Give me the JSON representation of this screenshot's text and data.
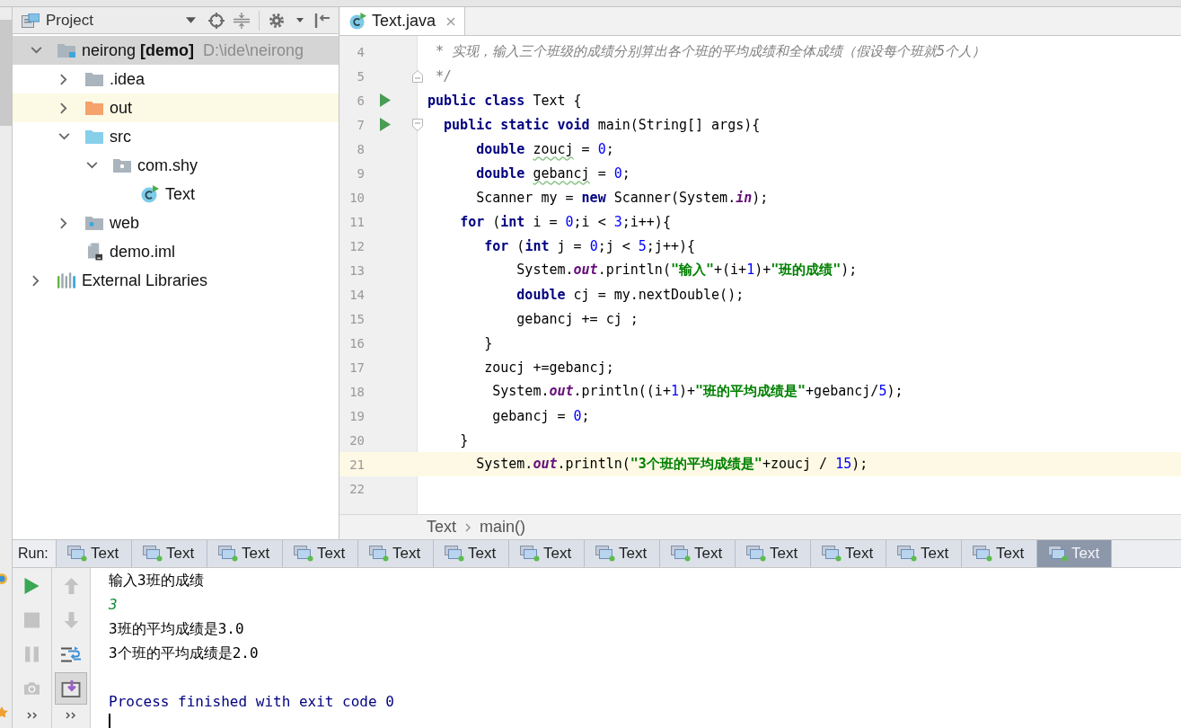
{
  "project_panel": {
    "title": "Project",
    "tree": [
      {
        "label": "neirong **[demo]**",
        "path": "D:\\ide\\neirong",
        "kind": "module",
        "expanded": true,
        "selected": true,
        "children": [
          {
            "label": ".idea",
            "kind": "folder",
            "expanded": false,
            "selected": false
          },
          {
            "label": "out",
            "kind": "excluded_folder",
            "expanded": false,
            "selected": false,
            "highlighted": true
          },
          {
            "label": "src",
            "kind": "source_folder",
            "expanded": true,
            "selected": false,
            "children": [
              {
                "label": "com.shy",
                "kind": "package",
                "expanded": true,
                "selected": false,
                "children": [
                  {
                    "label": "Text",
                    "kind": "class",
                    "selected": false
                  }
                ]
              }
            ]
          },
          {
            "label": "web",
            "kind": "web_folder",
            "expanded": false,
            "selected": false
          },
          {
            "label": "demo.iml",
            "kind": "module_file",
            "selected": false
          }
        ]
      },
      {
        "label": "External Libraries",
        "kind": "library",
        "expanded": false,
        "selected": false
      }
    ]
  },
  "editor": {
    "tabs": [
      {
        "label": "Text.java",
        "selected": true
      }
    ],
    "lines": [
      {
        "number": "4",
        "run_marker": false,
        "current": false,
        "tokens": [
          {
            "kind": "comment",
            "text": " * 实现，输入三个班级的成绩分别算出各个班的平均成绩和全体成绩（假设每个班就5个人）"
          }
        ]
      },
      {
        "number": "5",
        "run_marker": false,
        "current": false,
        "fold_end": true,
        "tokens": [
          {
            "kind": "comment",
            "text": " */"
          }
        ]
      },
      {
        "number": "6",
        "run_marker": true,
        "current": false,
        "tokens": [
          {
            "kind": "keyword",
            "text": "public class"
          },
          {
            "kind": "plain",
            "text": " Text {"
          }
        ]
      },
      {
        "number": "7",
        "run_marker": true,
        "current": false,
        "fold_start": true,
        "tokens": [
          {
            "kind": "keyword",
            "text": "  public static void"
          },
          {
            "kind": "plain",
            "text": " main(String[] args){"
          }
        ]
      },
      {
        "number": "8",
        "run_marker": false,
        "current": false,
        "tokens": [
          {
            "kind": "keyword",
            "text": "      double "
          },
          {
            "kind": "typo",
            "text": "zoucj"
          },
          {
            "kind": "plain",
            "text": " = "
          },
          {
            "kind": "number",
            "text": "0"
          },
          {
            "kind": "plain",
            "text": ";"
          }
        ]
      },
      {
        "number": "9",
        "run_marker": false,
        "current": false,
        "tokens": [
          {
            "kind": "keyword",
            "text": "      double "
          },
          {
            "kind": "typo",
            "text": "gebancj"
          },
          {
            "kind": "plain",
            "text": " = "
          },
          {
            "kind": "number",
            "text": "0"
          },
          {
            "kind": "plain",
            "text": ";"
          }
        ]
      },
      {
        "number": "10",
        "run_marker": false,
        "current": false,
        "tokens": [
          {
            "kind": "plain",
            "text": "      Scanner my = "
          },
          {
            "kind": "keyword",
            "text": "new"
          },
          {
            "kind": "plain",
            "text": " Scanner(System."
          },
          {
            "kind": "static_field",
            "text": "in"
          },
          {
            "kind": "plain",
            "text": ");"
          }
        ]
      },
      {
        "number": "11",
        "run_marker": false,
        "current": false,
        "tokens": [
          {
            "kind": "keyword",
            "text": "    for"
          },
          {
            "kind": "plain",
            "text": " ("
          },
          {
            "kind": "keyword",
            "text": "int"
          },
          {
            "kind": "plain",
            "text": " i = "
          },
          {
            "kind": "number",
            "text": "0"
          },
          {
            "kind": "plain",
            "text": ";i < "
          },
          {
            "kind": "number",
            "text": "3"
          },
          {
            "kind": "plain",
            "text": ";i++){"
          }
        ]
      },
      {
        "number": "12",
        "run_marker": false,
        "current": false,
        "tokens": [
          {
            "kind": "keyword",
            "text": "       for"
          },
          {
            "kind": "plain",
            "text": " ("
          },
          {
            "kind": "keyword",
            "text": "int"
          },
          {
            "kind": "plain",
            "text": " j = "
          },
          {
            "kind": "number",
            "text": "0"
          },
          {
            "kind": "plain",
            "text": ";j < "
          },
          {
            "kind": "number",
            "text": "5"
          },
          {
            "kind": "plain",
            "text": ";j++){"
          }
        ]
      },
      {
        "number": "13",
        "run_marker": false,
        "current": false,
        "tokens": [
          {
            "kind": "plain",
            "text": "           System."
          },
          {
            "kind": "static_field",
            "text": "out"
          },
          {
            "kind": "plain",
            "text": ".println("
          },
          {
            "kind": "string",
            "text": "\"输入\""
          },
          {
            "kind": "plain",
            "text": "+(i+"
          },
          {
            "kind": "number",
            "text": "1"
          },
          {
            "kind": "plain",
            "text": ")+"
          },
          {
            "kind": "string",
            "text": "\"班的成绩\""
          },
          {
            "kind": "plain",
            "text": ");"
          }
        ]
      },
      {
        "number": "14",
        "run_marker": false,
        "current": false,
        "tokens": [
          {
            "kind": "keyword",
            "text": "           double"
          },
          {
            "kind": "plain",
            "text": " cj = my.nextDouble();"
          }
        ]
      },
      {
        "number": "15",
        "run_marker": false,
        "current": false,
        "tokens": [
          {
            "kind": "plain",
            "text": "           gebancj += cj ;"
          }
        ]
      },
      {
        "number": "16",
        "run_marker": false,
        "current": false,
        "tokens": [
          {
            "kind": "plain",
            "text": "       }"
          }
        ]
      },
      {
        "number": "17",
        "run_marker": false,
        "current": false,
        "tokens": [
          {
            "kind": "plain",
            "text": "       zoucj +=gebancj;"
          }
        ]
      },
      {
        "number": "18",
        "run_marker": false,
        "current": false,
        "tokens": [
          {
            "kind": "plain",
            "text": "        System."
          },
          {
            "kind": "static_field",
            "text": "out"
          },
          {
            "kind": "plain",
            "text": ".println((i+"
          },
          {
            "kind": "number",
            "text": "1"
          },
          {
            "kind": "plain",
            "text": ")+"
          },
          {
            "kind": "string",
            "text": "\"班的平均成绩是\""
          },
          {
            "kind": "plain",
            "text": "+gebancj/"
          },
          {
            "kind": "number",
            "text": "5"
          },
          {
            "kind": "plain",
            "text": ");"
          }
        ]
      },
      {
        "number": "19",
        "run_marker": false,
        "current": false,
        "tokens": [
          {
            "kind": "plain",
            "text": "        gebancj = "
          },
          {
            "kind": "number",
            "text": "0"
          },
          {
            "kind": "plain",
            "text": ";"
          }
        ]
      },
      {
        "number": "20",
        "run_marker": false,
        "current": false,
        "tokens": [
          {
            "kind": "plain",
            "text": "    }"
          }
        ]
      },
      {
        "number": "21",
        "run_marker": false,
        "current": true,
        "tokens": [
          {
            "kind": "plain",
            "text": "      System."
          },
          {
            "kind": "static_field",
            "text": "out"
          },
          {
            "kind": "plain",
            "text": ".println("
          },
          {
            "kind": "string",
            "text": "\"3个班的平均成绩是\""
          },
          {
            "kind": "plain",
            "text": "+zoucj / "
          },
          {
            "kind": "number",
            "text": "15"
          },
          {
            "kind": "plain",
            "text": ");"
          }
        ]
      },
      {
        "number": "22",
        "run_marker": false,
        "current": false
      }
    ],
    "breadcrumbs": [
      "Text",
      "main()"
    ]
  },
  "run_panel": {
    "label": "Run:",
    "tabs": [
      {
        "label": "Text",
        "selected": false
      },
      {
        "label": "Text",
        "selected": false
      },
      {
        "label": "Text",
        "selected": false
      },
      {
        "label": "Text",
        "selected": false
      },
      {
        "label": "Text",
        "selected": false
      },
      {
        "label": "Text",
        "selected": false
      },
      {
        "label": "Text",
        "selected": false
      },
      {
        "label": "Text",
        "selected": false
      },
      {
        "label": "Text",
        "selected": false
      },
      {
        "label": "Text",
        "selected": false
      },
      {
        "label": "Text",
        "selected": false
      },
      {
        "label": "Text",
        "selected": false
      },
      {
        "label": "Text",
        "selected": false
      },
      {
        "label": "Text",
        "selected": true
      }
    ],
    "run_toolbar": [
      {
        "kind": "rerun",
        "disabled": false
      },
      {
        "kind": "stop",
        "disabled": true
      },
      {
        "kind": "pause",
        "disabled": true
      },
      {
        "kind": "dump",
        "disabled": true
      },
      {
        "kind": "more",
        "disabled": false
      }
    ],
    "console_toolbar": [
      {
        "kind": "up",
        "disabled": true,
        "on": false
      },
      {
        "kind": "down",
        "disabled": true,
        "on": false
      },
      {
        "kind": "wrap",
        "disabled": false,
        "on": false
      },
      {
        "kind": "scroll_end",
        "disabled": false,
        "on": true
      },
      {
        "kind": "more",
        "disabled": false,
        "on": false
      }
    ],
    "console": [
      {
        "kind": "output",
        "text": "输入3班的成绩"
      },
      {
        "kind": "input",
        "text": "3"
      },
      {
        "kind": "output",
        "text": "3班的平均成绩是3.0"
      },
      {
        "kind": "output",
        "text": "3个班的平均成绩是2.0"
      },
      {
        "kind": "system",
        "text": "Process finished with exit code 0"
      }
    ]
  }
}
